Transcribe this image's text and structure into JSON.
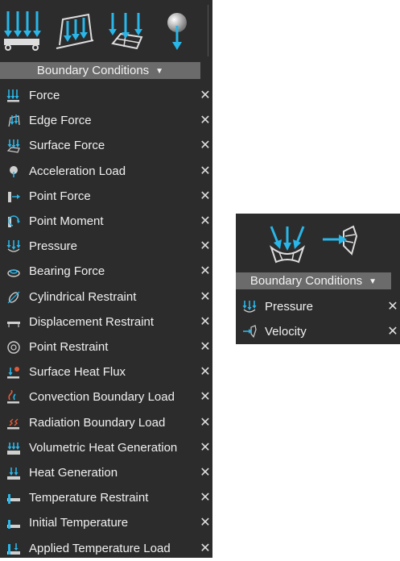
{
  "left_panel": {
    "header_label": "Boundary Conditions",
    "toolbar": [
      "force-tool",
      "edge-force-tool",
      "surface-force-tool",
      "acceleration-load-tool"
    ],
    "items": [
      {
        "label": "Force",
        "icon": "force-icon"
      },
      {
        "label": "Edge Force",
        "icon": "edge-force-icon"
      },
      {
        "label": "Surface Force",
        "icon": "surface-force-icon"
      },
      {
        "label": "Acceleration Load",
        "icon": "acceleration-load-icon"
      },
      {
        "label": "Point Force",
        "icon": "point-force-icon"
      },
      {
        "label": "Point Moment",
        "icon": "point-moment-icon"
      },
      {
        "label": "Pressure",
        "icon": "pressure-icon"
      },
      {
        "label": "Bearing Force",
        "icon": "bearing-force-icon"
      },
      {
        "label": "Cylindrical Restraint",
        "icon": "cylindrical-restraint-icon"
      },
      {
        "label": "Displacement Restraint",
        "icon": "displacement-restraint-icon"
      },
      {
        "label": "Point Restraint",
        "icon": "point-restraint-icon"
      },
      {
        "label": "Surface Heat Flux",
        "icon": "surface-heat-flux-icon"
      },
      {
        "label": "Convection Boundary Load",
        "icon": "convection-icon"
      },
      {
        "label": "Radiation Boundary Load",
        "icon": "radiation-icon"
      },
      {
        "label": "Volumetric Heat Generation",
        "icon": "volumetric-heat-icon"
      },
      {
        "label": "Heat Generation",
        "icon": "heat-generation-icon"
      },
      {
        "label": "Temperature Restraint",
        "icon": "temperature-restraint-icon"
      },
      {
        "label": "Initial Temperature",
        "icon": "initial-temperature-icon"
      },
      {
        "label": "Applied Temperature Load",
        "icon": "applied-temperature-icon"
      }
    ]
  },
  "right_panel": {
    "header_label": "Boundary Conditions",
    "toolbar": [
      "pressure-tool",
      "velocity-tool"
    ],
    "items": [
      {
        "label": "Pressure",
        "icon": "pressure-icon"
      },
      {
        "label": "Velocity",
        "icon": "velocity-icon"
      }
    ]
  },
  "colors": {
    "panel_bg": "#2c2c2c",
    "header_bg": "#6b6b6b",
    "accent_blue": "#29b6e8",
    "text": "#f0f0f0"
  },
  "close_glyph": "✕",
  "caret_glyph": "▼"
}
